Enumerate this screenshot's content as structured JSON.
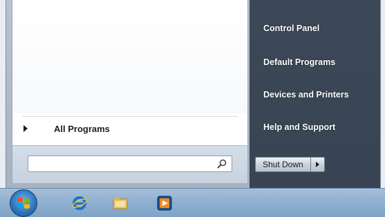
{
  "start_menu": {
    "all_programs_label": "All Programs",
    "search": {
      "value": "",
      "placeholder": ""
    },
    "right_items": [
      {
        "label": "Control Panel"
      },
      {
        "label": "Default Programs"
      },
      {
        "label": "Devices and Printers"
      },
      {
        "label": "Help and Support"
      }
    ],
    "shutdown_label": "Shut Down"
  },
  "taskbar": {
    "icons": [
      "windows-orb-icon",
      "internet-explorer-icon",
      "windows-explorer-icon",
      "media-player-icon"
    ]
  },
  "colors": {
    "right_pane": "#3c4858",
    "taskbar": "#8fb0d0",
    "left_pane": "#ffffff"
  }
}
